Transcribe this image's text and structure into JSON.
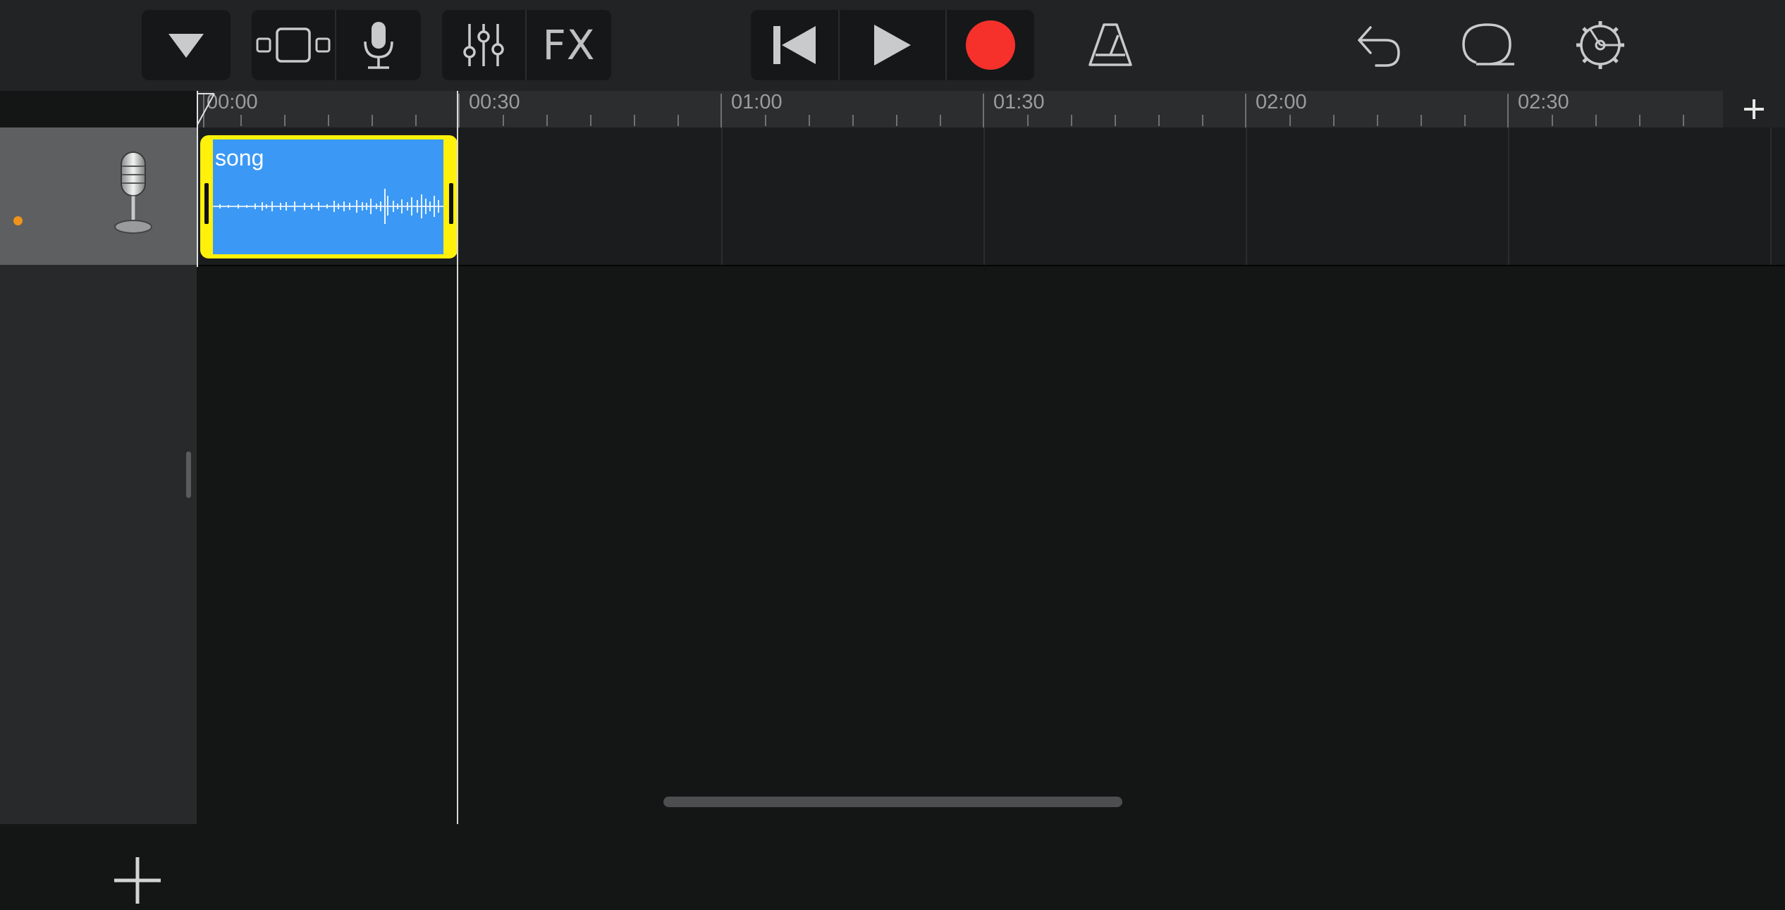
{
  "toolbar": {
    "buttons": [
      {
        "name": "browser-dropdown-button",
        "icon": "triangle-down-icon"
      },
      {
        "name": "tracks-view-button",
        "icon": "tracks-view-icon"
      },
      {
        "name": "instrument-button",
        "icon": "microphone-icon"
      },
      {
        "name": "mixer-button",
        "icon": "sliders-icon"
      },
      {
        "name": "fx-button",
        "label": "FX"
      },
      {
        "name": "go-to-start-button",
        "icon": "skip-back-icon"
      },
      {
        "name": "play-button",
        "icon": "play-icon"
      },
      {
        "name": "record-button",
        "icon": "record-icon",
        "color": "#f6312c"
      },
      {
        "name": "metronome-button",
        "icon": "metronome-icon"
      },
      {
        "name": "undo-button",
        "icon": "undo-icon"
      },
      {
        "name": "loop-browser-button",
        "icon": "loop-icon"
      },
      {
        "name": "settings-button",
        "icon": "gear-icon"
      }
    ],
    "fx_label": "FX"
  },
  "ruler": {
    "labels": [
      "00:00",
      "00:30",
      "01:00",
      "01:30",
      "02:00",
      "02:30"
    ],
    "add_section_icon": "plus-icon"
  },
  "tracks": [
    {
      "instrument_icon": "microphone-icon",
      "armed_dot_color": "#f0931a",
      "regions": [
        {
          "name": "song",
          "color": "#3b99f5",
          "selected": true,
          "selection_color": "#fff10b"
        }
      ]
    }
  ],
  "add_track_icon": "plus-icon"
}
